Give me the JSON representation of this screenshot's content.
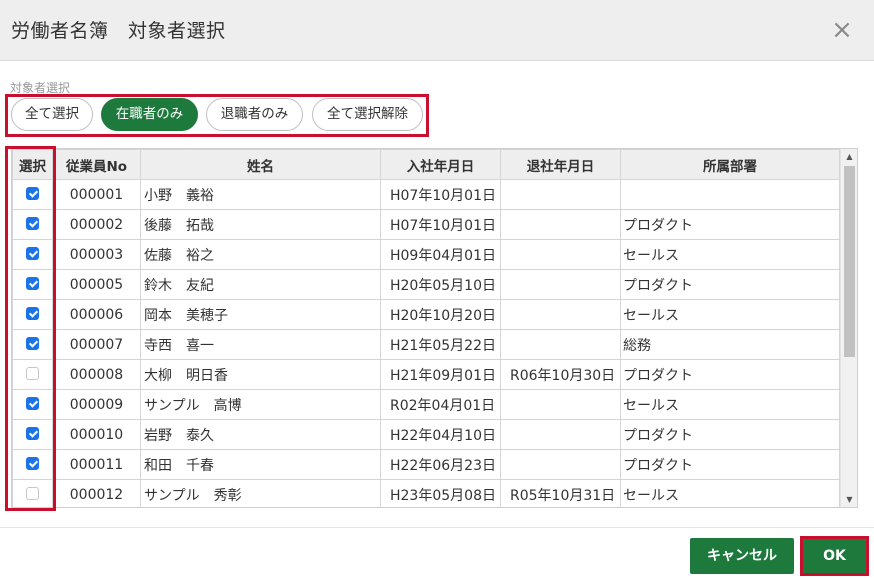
{
  "dialog": {
    "title": "労働者名簿　対象者選択",
    "close_label": "×"
  },
  "filter": {
    "label": "対象者選択",
    "buttons": [
      {
        "label": "全て選択",
        "active": false
      },
      {
        "label": "在職者のみ",
        "active": true
      },
      {
        "label": "退職者のみ",
        "active": false
      },
      {
        "label": "全て選択解除",
        "active": false
      }
    ]
  },
  "table": {
    "columns": [
      "選択",
      "従業員No",
      "姓名",
      "入社年月日",
      "退社年月日",
      "所属部署"
    ],
    "rows": [
      {
        "checked": true,
        "no": "000001",
        "name": "小野　義裕",
        "hire": "H07年10月01日",
        "leave": "",
        "dept": ""
      },
      {
        "checked": true,
        "no": "000002",
        "name": "後藤　拓哉",
        "hire": "H07年10月01日",
        "leave": "",
        "dept": "プロダクト"
      },
      {
        "checked": true,
        "no": "000003",
        "name": "佐藤　裕之",
        "hire": "H09年04月01日",
        "leave": "",
        "dept": "セールス"
      },
      {
        "checked": true,
        "no": "000005",
        "name": "鈴木　友紀",
        "hire": "H20年05月10日",
        "leave": "",
        "dept": "プロダクト"
      },
      {
        "checked": true,
        "no": "000006",
        "name": "岡本　美穂子",
        "hire": "H20年10月20日",
        "leave": "",
        "dept": "セールス"
      },
      {
        "checked": true,
        "no": "000007",
        "name": "寺西　喜一",
        "hire": "H21年05月22日",
        "leave": "",
        "dept": "総務"
      },
      {
        "checked": false,
        "no": "000008",
        "name": "大柳　明日香",
        "hire": "H21年09月01日",
        "leave": "R06年10月30日",
        "dept": "プロダクト"
      },
      {
        "checked": true,
        "no": "000009",
        "name": "サンプル　高博",
        "hire": "R02年04月01日",
        "leave": "",
        "dept": "セールス"
      },
      {
        "checked": true,
        "no": "000010",
        "name": "岩野　泰久",
        "hire": "H22年04月10日",
        "leave": "",
        "dept": "プロダクト"
      },
      {
        "checked": true,
        "no": "000011",
        "name": "和田　千春",
        "hire": "H22年06月23日",
        "leave": "",
        "dept": "プロダクト"
      },
      {
        "checked": false,
        "no": "000012",
        "name": "サンプル　秀彰",
        "hire": "H23年05月08日",
        "leave": "R05年10月31日",
        "dept": "セールス"
      }
    ]
  },
  "footer": {
    "cancel_label": "キャンセル",
    "ok_label": "OK"
  },
  "icons": {
    "checkbox_checked": "checkbox-checked-icon",
    "checkbox_unchecked": "checkbox-unchecked-icon",
    "close": "close-icon"
  },
  "colors": {
    "accent_green": "#1e7a3c",
    "checkbox_blue": "#1a73e8",
    "highlight_red": "#c8102e"
  }
}
